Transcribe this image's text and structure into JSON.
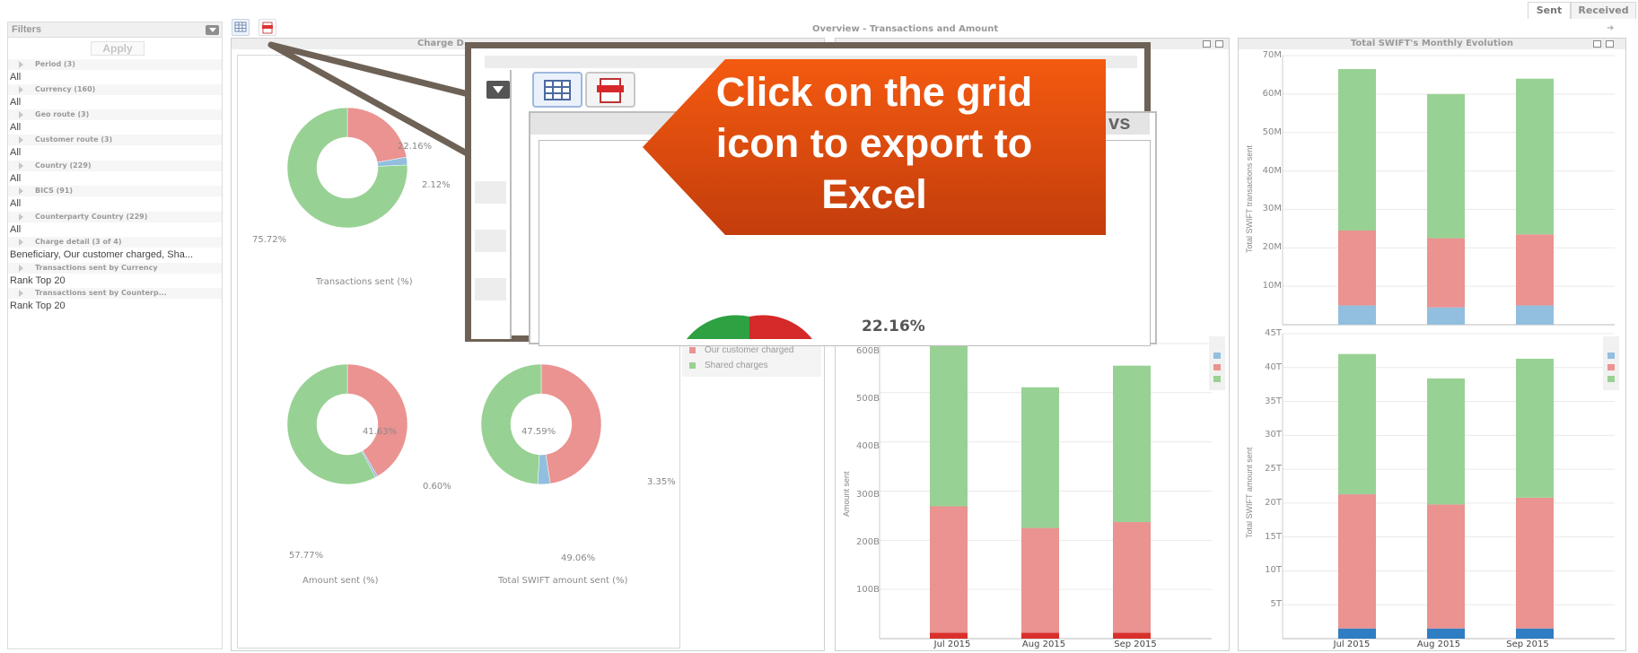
{
  "tabs": {
    "sent": "Sent",
    "received": "Received"
  },
  "filters": {
    "title": "Filters",
    "apply_label": "Apply",
    "items": [
      {
        "label": "Period (3)",
        "value": "All"
      },
      {
        "label": "Currency (160)",
        "value": "All"
      },
      {
        "label": "Geo route (3)",
        "value": "All"
      },
      {
        "label": "Customer route (3)",
        "value": "All"
      },
      {
        "label": "Country (229)",
        "value": "All"
      },
      {
        "label": "BICS (91)",
        "value": "All"
      },
      {
        "label": "Counterparty Country (229)",
        "value": "All"
      },
      {
        "label": "Charge detail (3 of 4)",
        "value": "Beneficiary, Our customer charged, Sha..."
      },
      {
        "label": "Transactions sent by Currency",
        "value": "Rank Top 20"
      },
      {
        "label": "Transactions sent by Counterp...",
        "value": "Rank Top 20"
      }
    ]
  },
  "overview_title": "Overview - Transactions and Amount",
  "charge_panel": {
    "title_fragment": "Charge D",
    "donuts": [
      {
        "caption": "Transactions sent (%)",
        "labels": [
          "22.16%",
          "2.12%",
          "75.72%"
        ]
      },
      {
        "caption": "Amount sent (%)",
        "labels": [
          "41.63%",
          "0.60%",
          "57.77%"
        ]
      },
      {
        "caption": "Total SWIFT amount sent (%)",
        "labels": [
          "47.59%",
          "3.35%",
          "49.06%"
        ]
      }
    ],
    "legend": [
      "Our customer charged",
      "Shared charges"
    ]
  },
  "middle_panel": {
    "ytitle": "Amount sent",
    "yticks": [
      "600B",
      "500B",
      "400B",
      "300B",
      "200B",
      "100B"
    ],
    "xticks": [
      "Jul 2015",
      "Aug 2015",
      "Sep 2015"
    ]
  },
  "right_panel": {
    "title": "Total SWIFT's Monthly Evolution",
    "top_ytitle": "Total SWIFT transactions sent",
    "top_yticks": [
      "70M",
      "60M",
      "50M",
      "40M",
      "30M",
      "20M",
      "10M"
    ],
    "bottom_ytitle": "Total SWIFT amount sent",
    "bottom_yticks": [
      "45T",
      "40T",
      "35T",
      "30T",
      "25T",
      "20T",
      "15T",
      "10T",
      "5T"
    ],
    "xticks": [
      "Jul 2015",
      "Aug 2015",
      "Sep 2015"
    ]
  },
  "chart_data": [
    {
      "type": "bar",
      "title": "",
      "ylabel": "Amount sent",
      "categories": [
        "Jul 2015",
        "Aug 2015",
        "Sep 2015"
      ],
      "ylim": [
        0,
        620
      ],
      "unit": "B",
      "series": [
        {
          "name": "",
          "values": [
            12,
            12,
            12
          ]
        },
        {
          "name": "Our customer charged",
          "values": [
            257,
            213,
            225
          ]
        },
        {
          "name": "Shared charges",
          "values": [
            326,
            286,
            318
          ]
        }
      ]
    },
    {
      "type": "bar",
      "title": "Total SWIFT's Monthly Evolution",
      "ylabel": "Total SWIFT transactions sent",
      "categories": [
        "Jul 2015",
        "Aug 2015",
        "Sep 2015"
      ],
      "ylim": [
        0,
        70
      ],
      "unit": "M",
      "series": [
        {
          "name": "",
          "values": [
            5,
            4.5,
            5
          ]
        },
        {
          "name": "Our customer charged",
          "values": [
            19.5,
            18,
            18.5
          ]
        },
        {
          "name": "Shared charges",
          "values": [
            42,
            37.5,
            40.5
          ]
        }
      ]
    },
    {
      "type": "bar",
      "title": "",
      "ylabel": "Total SWIFT amount sent",
      "categories": [
        "Jul 2015",
        "Aug 2015",
        "Sep 2015"
      ],
      "ylim": [
        0,
        45
      ],
      "unit": "T",
      "series": [
        {
          "name": "",
          "values": [
            1.5,
            1.5,
            1.5
          ]
        },
        {
          "name": "Our customer charged",
          "values": [
            19.8,
            18.3,
            19.3
          ]
        },
        {
          "name": "Shared charges",
          "values": [
            20.7,
            18.6,
            20.5
          ]
        }
      ]
    },
    {
      "type": "pie",
      "title": "Transactions sent (%)",
      "categories": [
        "Our customer charged",
        "Beneficiary",
        "Shared charges"
      ],
      "values": [
        22.16,
        2.12,
        75.72
      ]
    },
    {
      "type": "pie",
      "title": "Amount sent (%)",
      "categories": [
        "Our customer charged",
        "Beneficiary",
        "Shared charges"
      ],
      "values": [
        41.63,
        0.6,
        57.77
      ]
    },
    {
      "type": "pie",
      "title": "Total SWIFT amount sent (%)",
      "categories": [
        "Our customer charged",
        "Beneficiary",
        "Shared charges"
      ],
      "values": [
        47.59,
        3.35,
        49.06
      ]
    }
  ],
  "callout": {
    "lines": [
      "Click on the grid",
      "icon to export to",
      "Excel"
    ],
    "zoom_percent": "22.16%",
    "zoom_header_fragment": "vs"
  },
  "colors": {
    "green": "#98d194",
    "red": "#ea9391",
    "blue": "#92bfdf",
    "darkred": "#d9302c",
    "darkblue": "#2f7dc3",
    "orange": "#f05a14",
    "frame": "#6e6256"
  }
}
